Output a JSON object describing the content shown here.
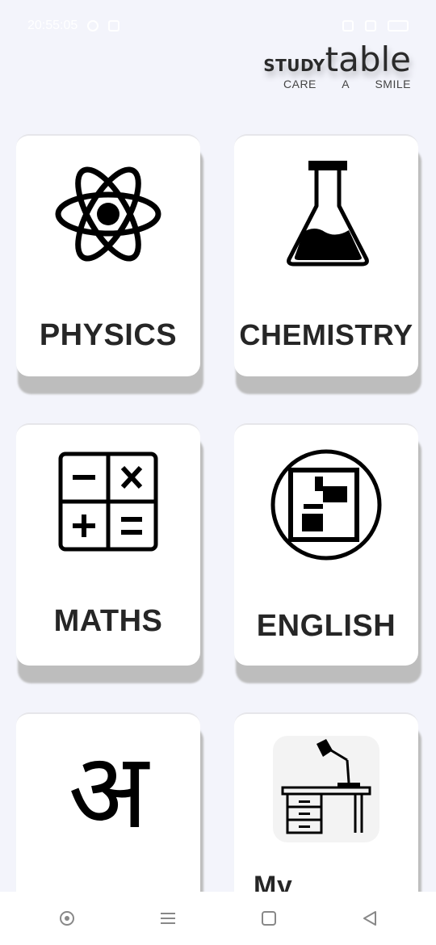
{
  "status_bar": {
    "time": "20:55:05"
  },
  "brand": {
    "study": "STUDY",
    "table": "table",
    "tagline": [
      "CARE",
      "A",
      "SMILE"
    ]
  },
  "subjects": [
    {
      "label": "PHYSICS",
      "icon": "atom-icon"
    },
    {
      "label": "CHEMISTRY",
      "icon": "flask-icon"
    },
    {
      "label": "MATHS",
      "icon": "calculator-icon"
    },
    {
      "label": "ENGLISH",
      "icon": "english-icon"
    },
    {
      "label": "",
      "icon": "hindi-letter-icon",
      "glyph": "अ"
    },
    {
      "label": "My",
      "icon": "desk-icon"
    }
  ],
  "nav": [
    "record-icon",
    "menu-icon",
    "home-square-icon",
    "back-triangle-icon"
  ]
}
